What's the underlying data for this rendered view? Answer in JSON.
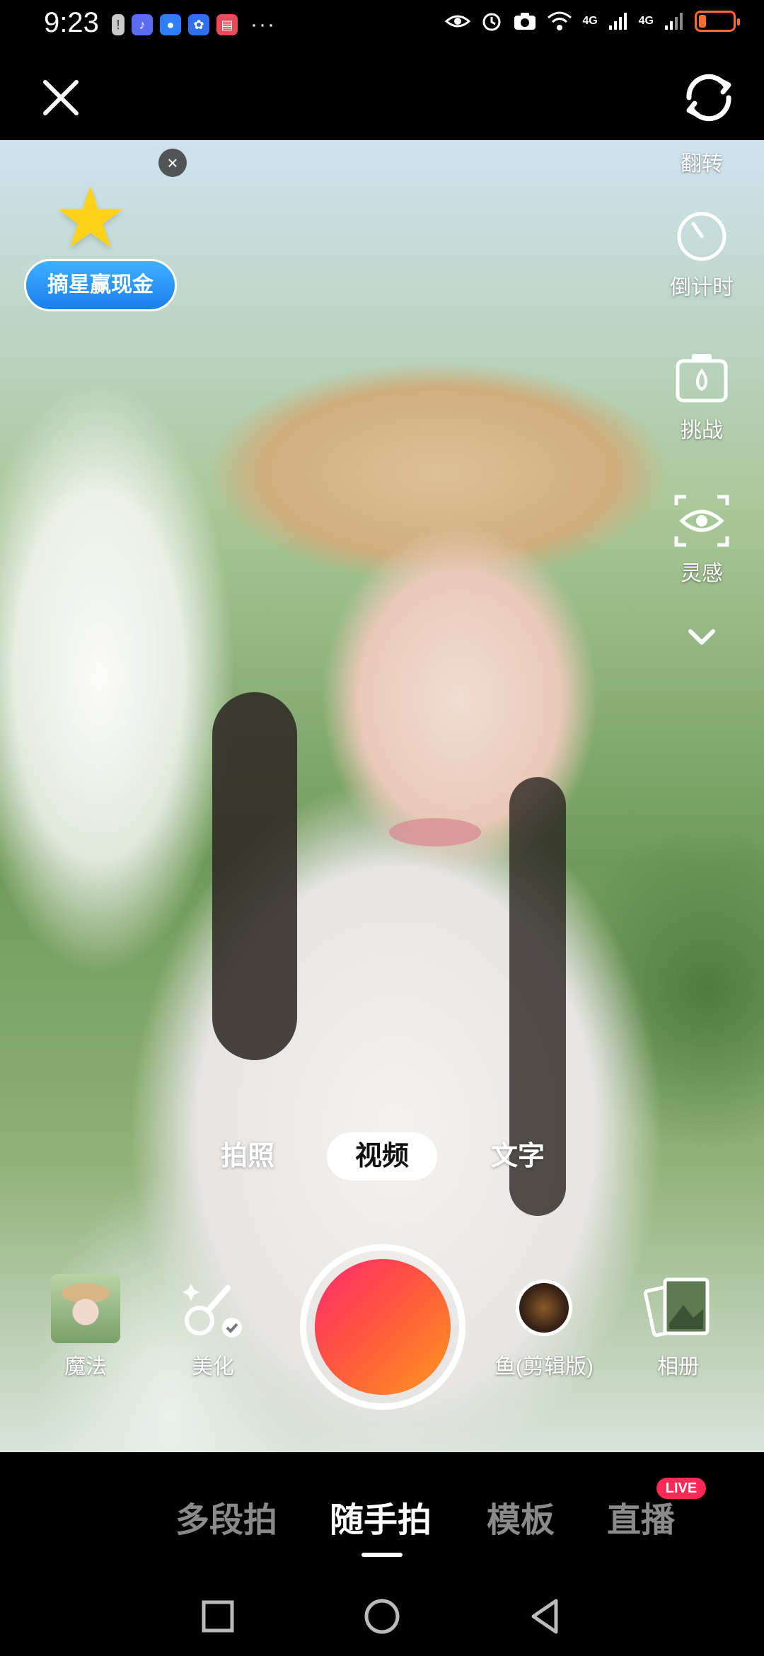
{
  "status_bar": {
    "time": "9:23",
    "network_1": "4G",
    "network_2": "4G",
    "battery_level": 0.2,
    "battery_color": "#ff6a30"
  },
  "promo": {
    "label": "摘星赢现金"
  },
  "right_tools": [
    {
      "icon": "flip-camera-icon",
      "label": "翻转"
    },
    {
      "icon": "timer-icon",
      "label": "倒计时"
    },
    {
      "icon": "challenge-icon",
      "label": "挑战"
    },
    {
      "icon": "inspiration-eye-icon",
      "label": "灵感"
    }
  ],
  "modes": {
    "photo": "拍照",
    "video": "视频",
    "text": "文字",
    "active": "视频"
  },
  "capture_row": {
    "magic": "魔法",
    "beautify": "美化",
    "music": "鱼(剪辑版)",
    "album": "相册"
  },
  "tabs": {
    "multi_segment": "多段拍",
    "casual": "随手拍",
    "template": "模板",
    "live": "直播",
    "live_badge": "LIVE",
    "active": "随手拍"
  },
  "colors": {
    "accent": "#ff2a55",
    "shutter_start": "#ff2a6d",
    "shutter_end": "#ff9a1f",
    "promo_blue": "#1b7ef0"
  }
}
